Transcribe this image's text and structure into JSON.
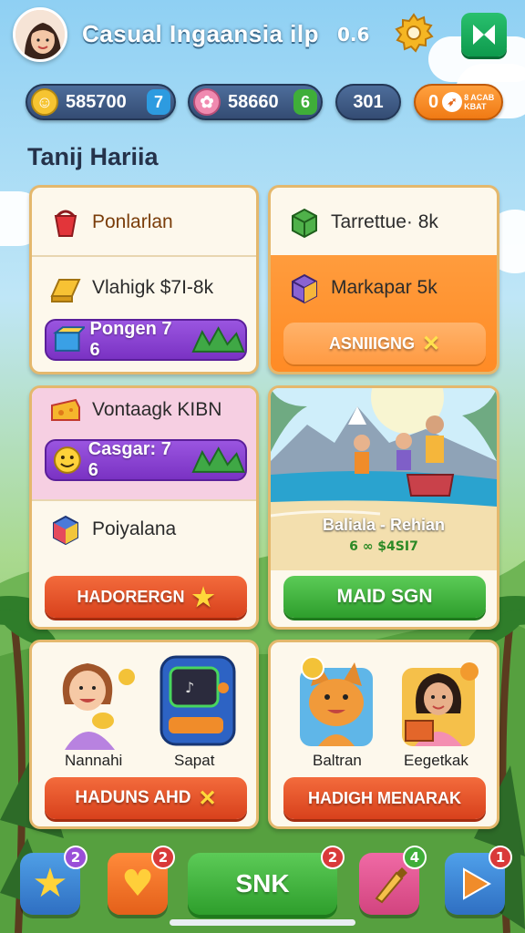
{
  "header": {
    "title": "Casual Ingaansia ilp",
    "version": "0.6",
    "avatar_icon": "girl-avatar",
    "settings_icon": "gear-icon",
    "action_icon": "bowtie-icon"
  },
  "currency": [
    {
      "icon": "smiley-coin-icon",
      "value": "585700",
      "badge": "7"
    },
    {
      "icon": "flower-gem-icon",
      "value": "58660",
      "badge": "6"
    },
    {
      "icon": "",
      "value": "301",
      "badge": ""
    },
    {
      "icon": "bird-icon",
      "value": "0",
      "sub": "8 ACAB\nKBAT",
      "badge": ""
    }
  ],
  "section_title": "Tanij Hariia",
  "cards": {
    "top_left": {
      "row1": "Ponlarlan",
      "row2": "Vlahigk $7I-8k",
      "pill": "Pongen 7 6"
    },
    "top_right": {
      "row1": "Tarrettue· 8k",
      "row2": "Markapar 5k",
      "button": "ASNIIIGNG"
    },
    "mid_left": {
      "row1": "Vontaagk KIBN",
      "pill": "Casgar: 7 6",
      "row2": "Poiyalana",
      "button": "HADORERGN"
    },
    "mid_right": {
      "caption": "Baliala - Rehian",
      "sub": "6 ∞ $4SI7",
      "button": "MAID SGN"
    },
    "bottom_left": {
      "label1": "Nannahi",
      "label2": "Sapat",
      "button": "HADUNS AHD"
    },
    "bottom_right": {
      "label1": "Baltran",
      "label2": "Eegetkak",
      "button": "HADIGH MENARAK"
    }
  },
  "nav": {
    "star_badge": "2",
    "heart_badge": "2",
    "main_label": "SNK",
    "main_badge": "2",
    "brush_badge": "4",
    "play_badge": "1"
  },
  "colors": {
    "accent_orange": "#ff8f2e",
    "accent_purple": "#8a3fd1",
    "accent_green": "#34a832",
    "accent_red": "#e2502a",
    "card_border": "#e4b86d"
  }
}
